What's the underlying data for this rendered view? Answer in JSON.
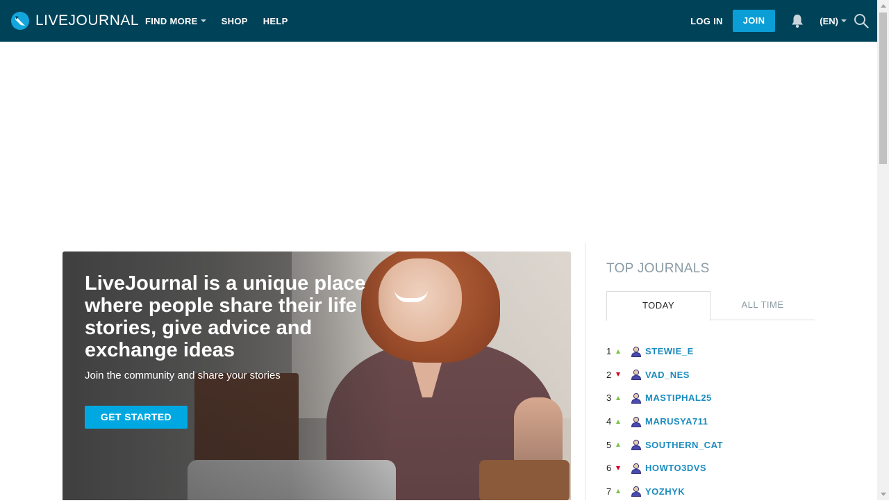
{
  "header": {
    "logo_text": "LIVEJOURNAL",
    "nav": [
      {
        "label": "FIND MORE",
        "has_caret": true
      },
      {
        "label": "SHOP",
        "has_caret": false
      },
      {
        "label": "HELP",
        "has_caret": false
      }
    ],
    "login_label": "LOG IN",
    "join_label": "JOIN",
    "language": "(EN)",
    "bell_icon": "bell-icon",
    "search_icon": "search-icon"
  },
  "hero": {
    "title": "LiveJournal is a unique place where people share their life stories, give advice and exchange ideas",
    "subtitle": "Join the community and share your stories",
    "cta_label": "GET STARTED"
  },
  "sidebar": {
    "title": "TOP JOURNALS",
    "tabs": [
      {
        "label": "TODAY",
        "active": true
      },
      {
        "label": "ALL TIME",
        "active": false
      }
    ],
    "journals": [
      {
        "rank": "1",
        "trend": "up",
        "name": "STEWIE_E"
      },
      {
        "rank": "2",
        "trend": "down",
        "name": "VAD_NES"
      },
      {
        "rank": "3",
        "trend": "up",
        "name": "MASTIPHAL25"
      },
      {
        "rank": "4",
        "trend": "up",
        "name": "MARUSYA711"
      },
      {
        "rank": "5",
        "trend": "up",
        "name": "SOUTHERN_CAT"
      },
      {
        "rank": "6",
        "trend": "down",
        "name": "HOWTO3DVS"
      },
      {
        "rank": "7",
        "trend": "up",
        "name": "YOZHYK"
      }
    ]
  },
  "colors": {
    "header_bg": "#004359",
    "join_bg": "#0b9ed6",
    "cta_bg": "#00a8e1",
    "link": "#1c8bbf",
    "trend_up": "#7ac143",
    "trend_down": "#d0021b"
  }
}
